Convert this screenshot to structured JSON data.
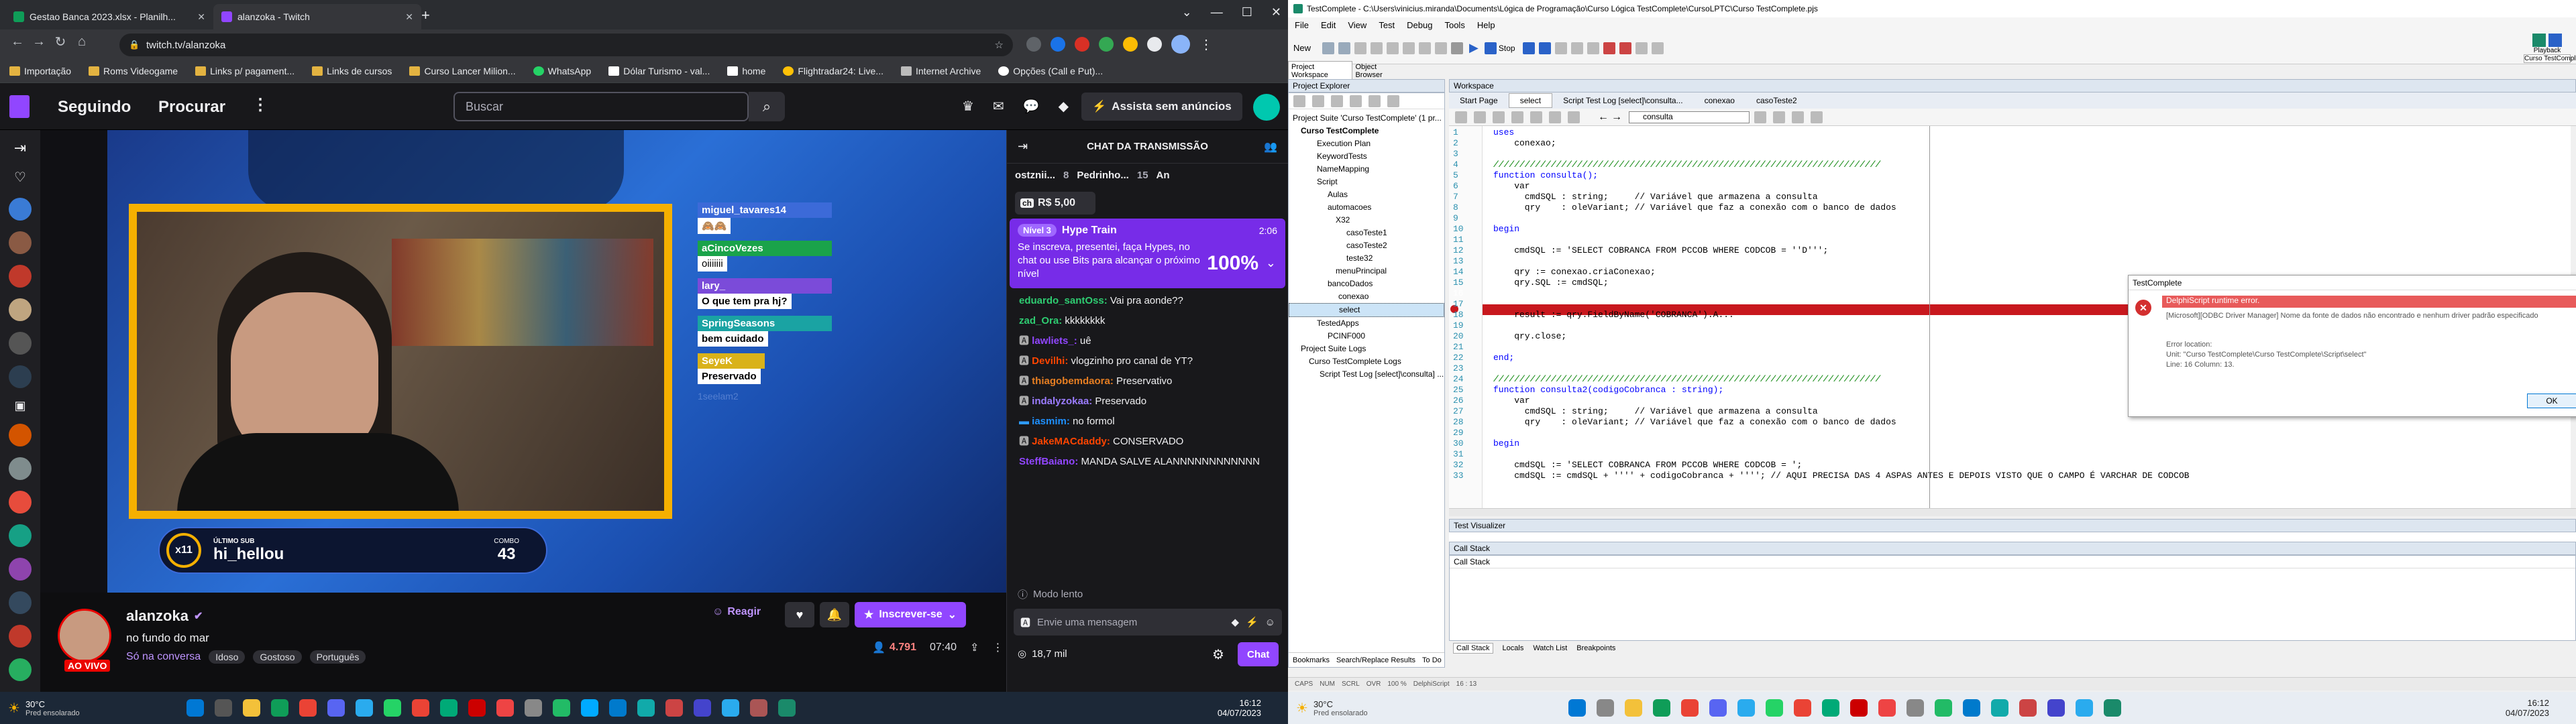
{
  "chrome": {
    "tabs": [
      {
        "title": "Gestao Banca 2023.xlsx - Planilh...",
        "fav": "#0f9d58"
      },
      {
        "title": "alanzoka - Twitch",
        "fav": "#9146ff"
      }
    ],
    "url": "twitch.tv/alanzoka",
    "bookmarks": [
      "Importação",
      "Roms Videogame",
      "Links p/ pagament...",
      "Links de cursos",
      "Curso Lancer Milion...",
      "WhatsApp",
      "Dólar Turismo - val...",
      "home",
      "Flightradar24: Live...",
      "Internet Archive",
      "Opções (Call e Put)..."
    ]
  },
  "twitch": {
    "nav": [
      "Seguindo",
      "Procurar"
    ],
    "search_placeholder": "Buscar",
    "ads_button": "Assista sem anúncios",
    "overlay": {
      "last_sub_label": "ÚLTIMO SUB",
      "last_sub_name": "hi_hellou",
      "badge": "x11",
      "combo_label": "COMBO",
      "combo_value": "43",
      "video_chat": [
        {
          "user": "miguel_tavares14",
          "text": "🙈🙈"
        },
        {
          "user": "aCincoVezes",
          "text": "oiiiiiii"
        },
        {
          "user": "lary_",
          "text": "O que tem pra hj?"
        },
        {
          "user": "SpringSeasons",
          "text": "bem cuidado"
        },
        {
          "user": "SeyeK",
          "text": "Preservado"
        }
      ],
      "faded": "1seelam2"
    },
    "channel": {
      "name": "alanzoka",
      "live": "AO VIVO",
      "title": "no fundo do mar",
      "category": "Só na conversa",
      "tags": [
        "Idoso",
        "Gostoso",
        "Português"
      ],
      "viewers": "4.791",
      "uptime": "07:40",
      "rewards": "Reagir",
      "subscribe": "Inscrever-se"
    },
    "chat": {
      "header": "CHAT DA TRANSMISSÃO",
      "top_users": [
        "ostznii...",
        "8",
        "Pedrinho...",
        "15",
        "An"
      ],
      "bits_badge": "R$ 5,00",
      "hype": {
        "level": "Nível 3",
        "title": "Hype Train",
        "time": "2:06",
        "text": "Se inscreva, presentei, faça Hypes, no chat ou use Bits para alcançar o próximo nível",
        "percent": "100%"
      },
      "messages": [
        {
          "user": "eduardo_santOss:",
          "text": " Vai pra aonde??",
          "color": "#2ecc71"
        },
        {
          "user": "zad_Ora:",
          "text": " kkkkkkkk",
          "color": "#2ecc71"
        },
        {
          "user": "lawliets_:",
          "text": " uê",
          "color": "#9146ff"
        },
        {
          "user": "Devilhi:",
          "text": " vlogzinho pro canal de YT?",
          "color": "#ff4500"
        },
        {
          "user": "thiagobemdaora:",
          "text": " Preservativo",
          "color": "#e67e22"
        },
        {
          "user": "indalyzokaa:",
          "text": " Preservado",
          "color": "#9b7cff"
        },
        {
          "user": "iasmim:",
          "text": " no formol",
          "color": "#1e90ff"
        },
        {
          "user": "JakeMACdaddy:",
          "text": " CONSERVADO",
          "color": "#ff4500"
        },
        {
          "user": "SteffBaiano:",
          "text": " MANDA SALVE ALANNNNNNNNNNNN",
          "color": "#9146ff"
        }
      ],
      "slow_mode": "Modo lento",
      "input_placeholder": "Envie uma mensagem",
      "points": "18,7 mil",
      "send": "Chat"
    }
  },
  "taskbar_left": {
    "temp": "30°C",
    "weather": "Pred ensolarado",
    "time": "16:12",
    "date": "04/07/2023"
  },
  "taskbar_right": {
    "temp": "30°C",
    "weather": "Pred ensolarado",
    "time": "16:12",
    "date": "04/07/2023"
  },
  "tc": {
    "title": "TestComplete - C:\\Users\\vinicius.miranda\\Documents\\Lógica de Programação\\Curso Lógica TestComplete\\CursoLPTC\\Curso TestComplete.pjs",
    "menu": [
      "File",
      "Edit",
      "View",
      "Test",
      "Debug",
      "Tools",
      "Help"
    ],
    "new_label": "New",
    "stop_label": "Stop",
    "playback": "Playback",
    "playback_name": "Curso TestComplete",
    "panel_tabs": [
      "Project Workspace",
      "Object Browser"
    ],
    "explorer_title": "Project Explorer",
    "workspace_title": "Workspace",
    "editor_tabs": [
      "Start Page",
      "select",
      "Script Test Log [select]\\consulta...",
      "conexao",
      "casoTeste2"
    ],
    "routine": "consulta",
    "tree": [
      "Project Suite 'Curso TestComplete' (1 pr...",
      "Curso TestComplete",
      "Execution Plan",
      "KeywordTests",
      "NameMapping",
      "Script",
      "Aulas",
      "automacoes",
      "X32",
      "casoTeste1",
      "casoTeste2",
      "teste32",
      "menuPrincipal",
      "bancoDados",
      "conexao",
      "select",
      "TestedApps",
      "PCINF000",
      "Project Suite Logs",
      "Curso TestComplete Logs",
      "Script Test Log [select]\\consulta] ..."
    ],
    "code": [
      {
        "n": "1",
        "t": "uses"
      },
      {
        "n": "2",
        "t": "    conexao;"
      },
      {
        "n": "3",
        "t": ""
      },
      {
        "n": "4",
        "t": "//////////////////////////////////////////////////////////////////////////"
      },
      {
        "n": "5",
        "t": "function consulta();"
      },
      {
        "n": "6",
        "t": "    var"
      },
      {
        "n": "7",
        "t": "      cmdSQL : string;     // Variável que armazena a consulta"
      },
      {
        "n": "8",
        "t": "      qry    : oleVariant; // Variável que faz a conexão com o banco de dados"
      },
      {
        "n": "9",
        "t": ""
      },
      {
        "n": "10",
        "t": "begin"
      },
      {
        "n": "11",
        "t": ""
      },
      {
        "n": "12",
        "t": "    cmdSQL := 'SELECT COBRANCA FROM PCCOB WHERE CODCOB = ''D''';"
      },
      {
        "n": "13",
        "t": ""
      },
      {
        "n": "14",
        "t": "    qry := conexao.criaConexao;"
      },
      {
        "n": "15",
        "t": "    qry.SQL := cmdSQL;"
      },
      {
        "n": "16",
        "t": "    qry.Open;"
      },
      {
        "n": "17",
        "t": ""
      },
      {
        "n": "18",
        "t": "    result := qry.FieldByName('COBRANCA').A..."
      },
      {
        "n": "19",
        "t": ""
      },
      {
        "n": "20",
        "t": "    qry.close;"
      },
      {
        "n": "21",
        "t": ""
      },
      {
        "n": "22",
        "t": "end;"
      },
      {
        "n": "23",
        "t": ""
      },
      {
        "n": "24",
        "t": "//////////////////////////////////////////////////////////////////////////"
      },
      {
        "n": "25",
        "t": "function consulta2(codigoCobranca : string);"
      },
      {
        "n": "26",
        "t": "    var"
      },
      {
        "n": "27",
        "t": "      cmdSQL : string;     // Variável que armazena a consulta"
      },
      {
        "n": "28",
        "t": "      qry    : oleVariant; // Variável que faz a conexão com o banco de dados"
      },
      {
        "n": "29",
        "t": ""
      },
      {
        "n": "30",
        "t": "begin"
      },
      {
        "n": "31",
        "t": ""
      },
      {
        "n": "32",
        "t": "    cmdSQL := 'SELECT COBRANCA FROM PCCOB WHERE CODCOB = ';"
      },
      {
        "n": "33",
        "t": "    cmdSQL := cmdSQL + '''' + codigoCobranca + ''''; // AQUI PRECISA DAS 4 ASPAS ANTES E DEPOIS VISTO QUE O CAMPO É VARCHAR DE CODCOB"
      }
    ],
    "dialog": {
      "title": "TestComplete",
      "heading": "DelphiScript runtime error.",
      "message": "[Microsoft][ODBC Driver Manager] Nome da fonte de dados não encontrado e nenhum driver padrão especificado",
      "loc1": "Error location:",
      "loc2": "Unit: \"Curso TestComplete\\Curso TestComplete\\Script\\select\"",
      "loc3": "Line: 16 Column: 13.",
      "ok": "OK"
    },
    "test_visualizer": "Test Visualizer",
    "call_stack": "Call Stack",
    "bottom_tabs": [
      "Call Stack",
      "Locals",
      "Watch List",
      "Breakpoints"
    ],
    "left_bottom_tabs": [
      "Bookmarks",
      "Search/Replace Results",
      "To Do"
    ],
    "status": [
      "CAPS",
      "NUM",
      "SCRL",
      "OVR",
      "100 %",
      "DelphiScript",
      "16 : 13"
    ]
  }
}
